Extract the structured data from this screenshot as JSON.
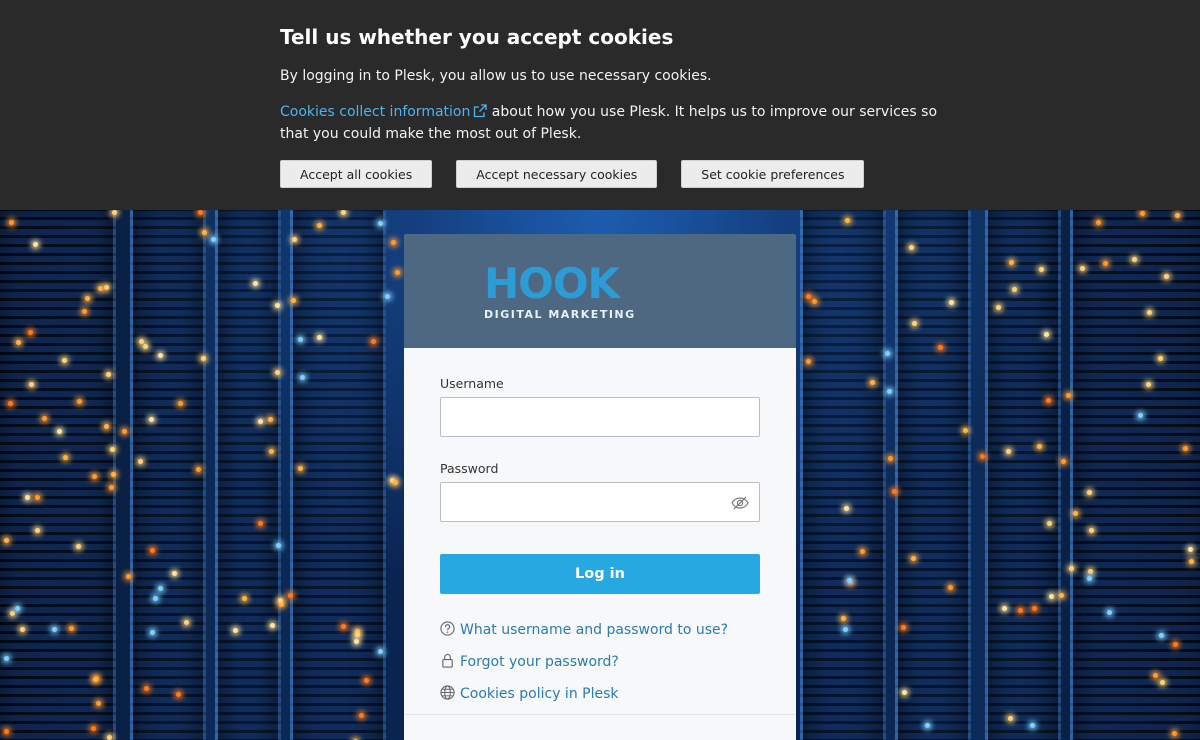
{
  "cookie_banner": {
    "title": "Tell us whether you accept cookies",
    "text1": "By logging in to Plesk, you allow us to use necessary cookies.",
    "link_text": "Cookies collect information",
    "text2_rest": " about how you use Plesk. It helps us to improve our services so that you could make the most out of Plesk.",
    "buttons": {
      "accept_all": "Accept all cookies",
      "accept_necessary": "Accept necessary cookies",
      "preferences": "Set cookie preferences"
    },
    "colors": {
      "background": "#2a2a2a",
      "link": "#4fb3f0"
    }
  },
  "logo": {
    "word": "HOOK",
    "sub": "DIGITAL MARKETING",
    "color": "#2d9bd6"
  },
  "login": {
    "username_label": "Username",
    "username_value": "",
    "password_label": "Password",
    "password_value": "",
    "submit_label": "Log in",
    "links": {
      "credentials_help": "What username and password to use?",
      "forgot_password": "Forgot your password?",
      "cookies_policy": "Cookies policy in Plesk"
    },
    "colors": {
      "header": "#4d6880",
      "button": "#28a8e0",
      "link": "#2b7bb0"
    }
  },
  "icons": {
    "external_link": "external-link-icon",
    "eye": "eye-slash-icon",
    "question": "question-circle-icon",
    "lock": "lock-icon",
    "globe": "globe-icon"
  }
}
